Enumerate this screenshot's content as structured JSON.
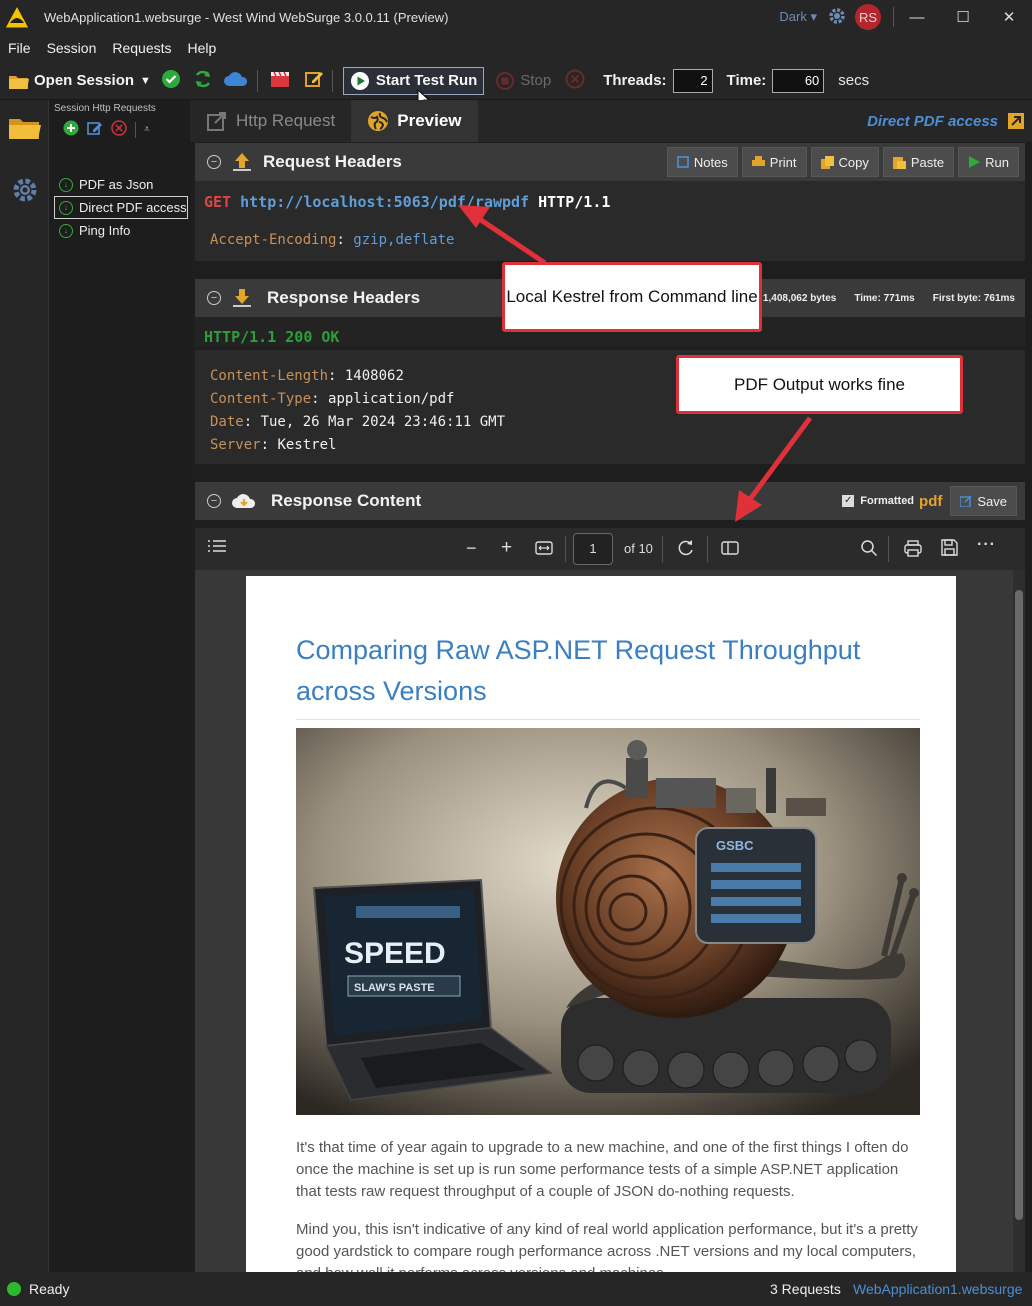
{
  "window": {
    "title": "WebApplication1.websurge - West Wind WebSurge 3.0.0.11 (Preview)",
    "theme": "Dark",
    "avatar_initials": "RS",
    "minimize": "—",
    "maximize": "☐",
    "close": "✕"
  },
  "menu": [
    "File",
    "Session",
    "Requests",
    "Help"
  ],
  "toolbar": {
    "open_session": "Open Session",
    "start_test_run": "Start Test Run",
    "stop": "Stop",
    "threads_label": "Threads:",
    "threads_value": "2",
    "time_label": "Time:",
    "time_value": "60",
    "time_unit": "secs"
  },
  "sidebar": {
    "caption": "Session Http Requests",
    "items": [
      {
        "label": "PDF as Json"
      },
      {
        "label": "Direct PDF access"
      },
      {
        "label": "Ping Info"
      }
    ]
  },
  "tabs": {
    "http_request": "Http Request",
    "preview": "Preview",
    "request_name": "Direct PDF access"
  },
  "request_headers": {
    "title": "Request Headers",
    "actions": [
      "Notes",
      "Print",
      "Copy",
      "Paste",
      "Run"
    ],
    "method": "GET",
    "url": "http://localhost:5063/pdf/rawpdf",
    "protocol": "HTTP/1.1",
    "header_key": "Accept-Encoding",
    "header_value": "gzip,deflate"
  },
  "response_headers": {
    "title": "Response Headers",
    "size": "1,408,062 bytes",
    "time_label": "Time:",
    "time_value": "771ms",
    "first_byte_label": "First byte:",
    "first_byte_value": "761ms",
    "status_line": "HTTP/1.1 200 OK",
    "headers": [
      {
        "key": "Content-Length",
        "value": "1408062"
      },
      {
        "key": "Content-Type",
        "value": "application/pdf"
      },
      {
        "key": "Date",
        "value": "Tue, 26 Mar 2024 23:46:11 GMT"
      },
      {
        "key": "Server",
        "value": "Kestrel"
      }
    ]
  },
  "response_content": {
    "title": "Response Content",
    "formatted_label": "Formatted",
    "format": "pdf",
    "save": "Save"
  },
  "pdf_viewer": {
    "page": "1",
    "of_pages": "of 10",
    "minus": "−",
    "plus": "+",
    "more": "···"
  },
  "pdf_document": {
    "title": "Comparing Raw ASP.NET Request Throughput across Versions",
    "image_text": {
      "speed": "SPEED",
      "sub": "SLAW'S PASTE",
      "snail_label": "GSBC"
    },
    "paragraph1": "It's that time of year again to upgrade to a new machine, and one of the first things I often do once the machine is set up is run some performance tests of a simple ASP.NET application that tests raw request throughput of a couple of JSON do-nothing requests.",
    "paragraph2": "Mind you, this isn't indicative of any kind of real world application performance, but it's a pretty good yardstick to compare rough performance across .NET versions and my local computers, and how well it performs across versions and machines."
  },
  "callouts": {
    "kestrel": "Local Kestrel from Command line",
    "pdf_output": "PDF Output works fine"
  },
  "status": {
    "ready": "Ready",
    "requests": "3 Requests",
    "file": "WebApplication1.websurge"
  },
  "colors": {
    "accent_blue": "#4d8fd6",
    "callout_red": "#e0313a",
    "ok_green": "#2eb82e",
    "method_red": "#e04545"
  }
}
